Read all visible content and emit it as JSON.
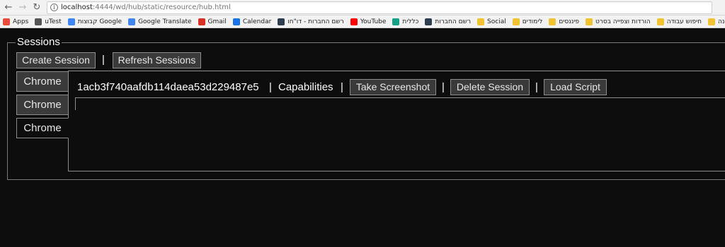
{
  "browser": {
    "url_host": "localhost",
    "url_path": ":4444/wd/hub/static/resource/hub.html"
  },
  "bookmarks": [
    {
      "label": "Apps",
      "icon": "apps-grid-icon",
      "color": "#e74c3c"
    },
    {
      "label": "uTest",
      "icon": "utest-icon",
      "color": "#555555"
    },
    {
      "label": "קבוצות Google",
      "icon": "google-icon",
      "color": "#4285f4"
    },
    {
      "label": "Google Translate",
      "icon": "translate-icon",
      "color": "#4285f4"
    },
    {
      "label": "Gmail",
      "icon": "gmail-icon",
      "color": "#d93025"
    },
    {
      "label": "Calendar",
      "icon": "calendar-icon",
      "color": "#1a73e8"
    },
    {
      "label": "רשם החברות - דו\"חו",
      "icon": "registry-icon",
      "color": "#2c3e50"
    },
    {
      "label": "YouTube",
      "icon": "youtube-icon",
      "color": "#ff0000"
    },
    {
      "label": "כללית",
      "icon": "clalit-icon",
      "color": "#16a085"
    },
    {
      "label": "רשם החברות",
      "icon": "registry-icon",
      "color": "#2c3e50"
    },
    {
      "label": "Social",
      "icon": "folder-icon",
      "color": "#f1c232"
    },
    {
      "label": "לימודים",
      "icon": "folder-icon",
      "color": "#f1c232"
    },
    {
      "label": "פיננסים",
      "icon": "folder-icon",
      "color": "#f1c232"
    },
    {
      "label": "הורדות וצפייה בסרט",
      "icon": "folder-icon",
      "color": "#f1c232"
    },
    {
      "label": "חיפוש עבודה",
      "icon": "folder-icon",
      "color": "#f1c232"
    },
    {
      "label": "חתונה",
      "icon": "folder-icon",
      "color": "#f1c232"
    }
  ],
  "sessions": {
    "legend": "Sessions",
    "create_label": "Create Session",
    "refresh_label": "Refresh Sessions",
    "separator": "|",
    "tabs": [
      {
        "label": "Chrome",
        "active": false
      },
      {
        "label": "Chrome",
        "active": false
      },
      {
        "label": "Chrome",
        "active": true
      }
    ],
    "detail": {
      "session_id": "1acb3f740aafdb114daea53d229487e5",
      "capabilities_label": "Capabilities",
      "screenshot_label": "Take Screenshot",
      "delete_label": "Delete Session",
      "load_script_label": "Load Script"
    }
  }
}
